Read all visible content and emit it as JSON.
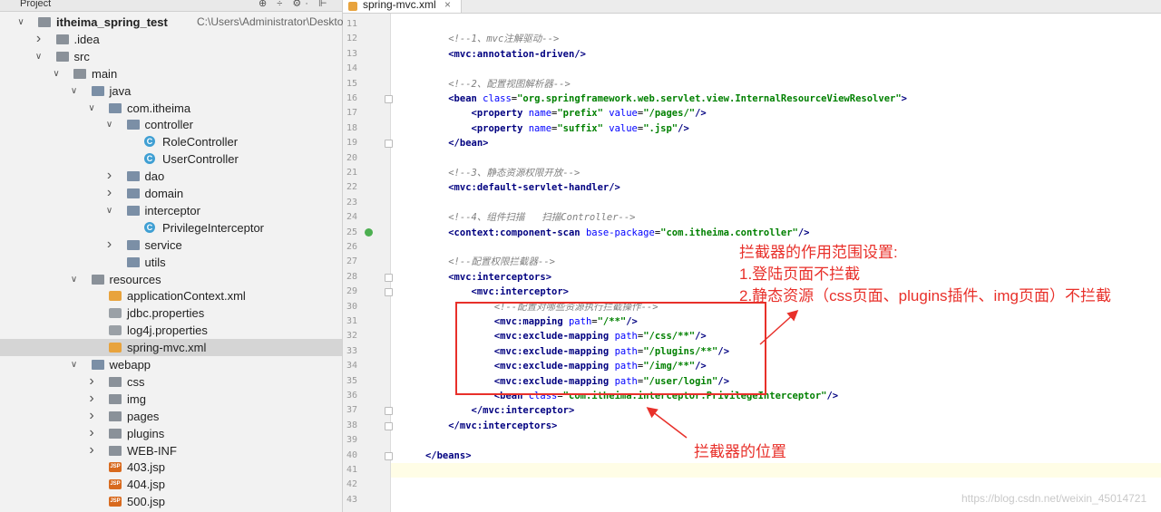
{
  "project_panel": {
    "title": "Project",
    "tools": "⊕ ÷ ⚙· ⊩",
    "tree": [
      {
        "label": "itheima_spring_test",
        "sub": "C:\\Users\\Administrator\\Desktop\\ithei",
        "indent": 0,
        "arrow": "down",
        "icon": "folder",
        "bold": true
      },
      {
        "label": ".idea",
        "indent": 1,
        "arrow": "right",
        "icon": "folder"
      },
      {
        "label": "src",
        "indent": 1,
        "arrow": "down",
        "icon": "folder"
      },
      {
        "label": "main",
        "indent": 2,
        "arrow": "down",
        "icon": "folder"
      },
      {
        "label": "java",
        "indent": 3,
        "arrow": "down",
        "icon": "folder-blue"
      },
      {
        "label": "com.itheima",
        "indent": 4,
        "arrow": "down",
        "icon": "package"
      },
      {
        "label": "controller",
        "indent": 5,
        "arrow": "down",
        "icon": "package"
      },
      {
        "label": "RoleController",
        "indent": 6,
        "arrow": "",
        "icon": "class"
      },
      {
        "label": "UserController",
        "indent": 6,
        "arrow": "",
        "icon": "class"
      },
      {
        "label": "dao",
        "indent": 5,
        "arrow": "right",
        "icon": "package"
      },
      {
        "label": "domain",
        "indent": 5,
        "arrow": "right",
        "icon": "package"
      },
      {
        "label": "interceptor",
        "indent": 5,
        "arrow": "down",
        "icon": "package"
      },
      {
        "label": "PrivilegeInterceptor",
        "indent": 6,
        "arrow": "",
        "icon": "class"
      },
      {
        "label": "service",
        "indent": 5,
        "arrow": "right",
        "icon": "package"
      },
      {
        "label": "utils",
        "indent": 5,
        "arrow": "",
        "icon": "package"
      },
      {
        "label": "resources",
        "indent": 3,
        "arrow": "down",
        "icon": "folder-res"
      },
      {
        "label": "applicationContext.xml",
        "indent": 4,
        "arrow": "",
        "icon": "xml"
      },
      {
        "label": "jdbc.properties",
        "indent": 4,
        "arrow": "",
        "icon": "properties"
      },
      {
        "label": "log4j.properties",
        "indent": 4,
        "arrow": "",
        "icon": "properties"
      },
      {
        "label": "spring-mvc.xml",
        "indent": 4,
        "arrow": "",
        "icon": "xml",
        "selected": true
      },
      {
        "label": "webapp",
        "indent": 3,
        "arrow": "down",
        "icon": "folder-blue"
      },
      {
        "label": "css",
        "indent": 4,
        "arrow": "right",
        "icon": "folder"
      },
      {
        "label": "img",
        "indent": 4,
        "arrow": "right",
        "icon": "folder"
      },
      {
        "label": "pages",
        "indent": 4,
        "arrow": "right",
        "icon": "folder"
      },
      {
        "label": "plugins",
        "indent": 4,
        "arrow": "right",
        "icon": "folder"
      },
      {
        "label": "WEB-INF",
        "indent": 4,
        "arrow": "right",
        "icon": "folder"
      },
      {
        "label": "403.jsp",
        "indent": 4,
        "arrow": "",
        "icon": "jsp"
      },
      {
        "label": "404.jsp",
        "indent": 4,
        "arrow": "",
        "icon": "jsp"
      },
      {
        "label": "500.jsp",
        "indent": 4,
        "arrow": "",
        "icon": "jsp"
      }
    ]
  },
  "editor": {
    "tab_label": "spring-mvc.xml",
    "tab_close": "×",
    "first_line": 11,
    "current_line": 41,
    "lines": [
      {
        "n": 11,
        "parts": []
      },
      {
        "n": 12,
        "parts": [
          [
            "t",
            "    "
          ],
          [
            "cm",
            "<!--1、mvc注解驱动-->"
          ]
        ]
      },
      {
        "n": 13,
        "parts": [
          [
            "t",
            "    "
          ],
          [
            "tg",
            "<mvc:annotation-driven/>"
          ]
        ]
      },
      {
        "n": 14,
        "parts": []
      },
      {
        "n": 15,
        "parts": [
          [
            "t",
            "    "
          ],
          [
            "cm",
            "<!--2、配置视图解析器-->"
          ]
        ]
      },
      {
        "n": 16,
        "parts": [
          [
            "t",
            "    "
          ],
          [
            "tg",
            "<bean "
          ],
          [
            "an",
            "class"
          ],
          [
            "t",
            "="
          ],
          [
            "av",
            "\"org.springframework.web.servlet.view.InternalResourceViewResolver\""
          ],
          [
            "tg",
            ">"
          ]
        ]
      },
      {
        "n": 17,
        "parts": [
          [
            "t",
            "        "
          ],
          [
            "tg",
            "<property "
          ],
          [
            "an",
            "name"
          ],
          [
            "t",
            "="
          ],
          [
            "av",
            "\"prefix\""
          ],
          [
            "t",
            " "
          ],
          [
            "an",
            "value"
          ],
          [
            "t",
            "="
          ],
          [
            "av",
            "\"/pages/\""
          ],
          [
            "tg",
            "/>"
          ]
        ]
      },
      {
        "n": 18,
        "parts": [
          [
            "t",
            "        "
          ],
          [
            "tg",
            "<property "
          ],
          [
            "an",
            "name"
          ],
          [
            "t",
            "="
          ],
          [
            "av",
            "\"suffix\""
          ],
          [
            "t",
            " "
          ],
          [
            "an",
            "value"
          ],
          [
            "t",
            "="
          ],
          [
            "av",
            "\".jsp\""
          ],
          [
            "tg",
            "/>"
          ]
        ]
      },
      {
        "n": 19,
        "parts": [
          [
            "t",
            "    "
          ],
          [
            "tg",
            "</bean>"
          ]
        ]
      },
      {
        "n": 20,
        "parts": []
      },
      {
        "n": 21,
        "parts": [
          [
            "t",
            "    "
          ],
          [
            "cm",
            "<!--3、静态资源权限开放-->"
          ]
        ]
      },
      {
        "n": 22,
        "parts": [
          [
            "t",
            "    "
          ],
          [
            "tg",
            "<mvc:default-servlet-handler/>"
          ]
        ]
      },
      {
        "n": 23,
        "parts": []
      },
      {
        "n": 24,
        "parts": [
          [
            "t",
            "    "
          ],
          [
            "cm",
            "<!--4、组件扫描   扫描Controller-->"
          ]
        ]
      },
      {
        "n": 25,
        "parts": [
          [
            "t",
            "    "
          ],
          [
            "tg",
            "<context:component-scan "
          ],
          [
            "an",
            "base-package"
          ],
          [
            "t",
            "="
          ],
          [
            "av",
            "\"com.itheima.controller\""
          ],
          [
            "tg",
            "/>"
          ]
        ]
      },
      {
        "n": 26,
        "parts": []
      },
      {
        "n": 27,
        "parts": [
          [
            "t",
            "    "
          ],
          [
            "cm",
            "<!--配置权限拦截器-->"
          ]
        ]
      },
      {
        "n": 28,
        "parts": [
          [
            "t",
            "    "
          ],
          [
            "tg",
            "<mvc:interceptors>"
          ]
        ]
      },
      {
        "n": 29,
        "parts": [
          [
            "t",
            "        "
          ],
          [
            "tg",
            "<mvc:interceptor>"
          ]
        ]
      },
      {
        "n": 30,
        "parts": [
          [
            "t",
            "            "
          ],
          [
            "cm",
            "<!--配置对哪些资源执行拦截操作-->"
          ]
        ]
      },
      {
        "n": 31,
        "parts": [
          [
            "t",
            "            "
          ],
          [
            "tg",
            "<mvc:mapping "
          ],
          [
            "an",
            "path"
          ],
          [
            "t",
            "="
          ],
          [
            "av",
            "\"/**\""
          ],
          [
            "tg",
            "/>"
          ]
        ]
      },
      {
        "n": 32,
        "parts": [
          [
            "t",
            "            "
          ],
          [
            "tg",
            "<mvc:exclude-mapping "
          ],
          [
            "an",
            "path"
          ],
          [
            "t",
            "="
          ],
          [
            "av",
            "\"/css/**\""
          ],
          [
            "tg",
            "/>"
          ]
        ]
      },
      {
        "n": 33,
        "parts": [
          [
            "t",
            "            "
          ],
          [
            "tg",
            "<mvc:exclude-mapping "
          ],
          [
            "an",
            "path"
          ],
          [
            "t",
            "="
          ],
          [
            "av",
            "\"/plugins/**\""
          ],
          [
            "tg",
            "/>"
          ]
        ]
      },
      {
        "n": 34,
        "parts": [
          [
            "t",
            "            "
          ],
          [
            "tg",
            "<mvc:exclude-mapping "
          ],
          [
            "an",
            "path"
          ],
          [
            "t",
            "="
          ],
          [
            "av",
            "\"/img/**\""
          ],
          [
            "tg",
            "/>"
          ]
        ]
      },
      {
        "n": 35,
        "parts": [
          [
            "t",
            "            "
          ],
          [
            "tg",
            "<mvc:exclude-mapping "
          ],
          [
            "an",
            "path"
          ],
          [
            "t",
            "="
          ],
          [
            "av",
            "\"/user/login\""
          ],
          [
            "tg",
            "/>"
          ]
        ]
      },
      {
        "n": 36,
        "parts": [
          [
            "t",
            "            "
          ],
          [
            "tg",
            "<bean "
          ],
          [
            "an",
            "class"
          ],
          [
            "t",
            "="
          ],
          [
            "av",
            "\"com.itheima.interceptor.PrivilegeInterceptor\""
          ],
          [
            "tg",
            "/>"
          ]
        ]
      },
      {
        "n": 37,
        "parts": [
          [
            "t",
            "        "
          ],
          [
            "tg",
            "</mvc:interceptor>"
          ]
        ]
      },
      {
        "n": 38,
        "parts": [
          [
            "t",
            "    "
          ],
          [
            "tg",
            "</mvc:interceptors>"
          ]
        ]
      },
      {
        "n": 39,
        "parts": []
      },
      {
        "n": 40,
        "parts": [
          [
            "tg",
            "</beans>"
          ]
        ]
      },
      {
        "n": 41,
        "parts": []
      },
      {
        "n": 42,
        "parts": []
      },
      {
        "n": 43,
        "parts": []
      }
    ]
  },
  "annotations": {
    "note_title": "拦截器的作用范围设置:",
    "note_line1": "1.登陆页面不拦截",
    "note_line2": "2.静态资源（css页面、plugins插件、img页面）不拦截",
    "position_label": "拦截器的位置",
    "color": "#e8302a"
  },
  "watermark": "https://blog.csdn.net/weixin_45014721"
}
